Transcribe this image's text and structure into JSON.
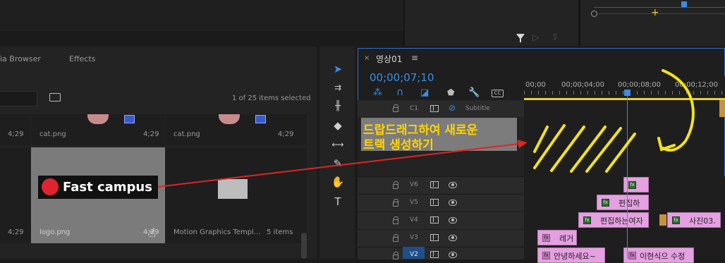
{
  "top": {
    "playhead_marker_color": "#3a8ee6"
  },
  "tabs": {
    "media_browser": "ia Browser",
    "effects": "Effects"
  },
  "project": {
    "items_count": "1 of 25 items selected",
    "thumbs": [
      {
        "name": "cat.png",
        "duration": "4;29"
      },
      {
        "name": "cat.png",
        "duration": "4;29"
      },
      {
        "name": "logo.png",
        "duration": "4;29"
      },
      {
        "name": "Motion Graphics Templ...",
        "count": "5 items"
      }
    ],
    "left_durations": [
      "4;29",
      "4;29"
    ],
    "logo_text": "Fast campus"
  },
  "timeline": {
    "tab_title": "영상01",
    "timecode": "00;00;07;10",
    "ruler": [
      "00;00",
      "00;00;04;00",
      "00;00;08;00",
      "00;00;12;00"
    ],
    "c1_label": "C1",
    "subtitle_label": "Subtitle",
    "tracks": [
      "V6",
      "V5",
      "V4",
      "V3",
      "V2"
    ],
    "annotation_line1": "드랍드래그하여 새로운",
    "annotation_line2": "트랙 생성하기",
    "clips": {
      "v5": "편집하",
      "v4a": "편집하는여자",
      "v4b": "사진03.",
      "v3": "레거",
      "v2a": "안녕하세요~",
      "v2b": "이현식으 수정"
    },
    "accent_color": "#3a8ee6",
    "clip_color": "#e4a0e0"
  }
}
